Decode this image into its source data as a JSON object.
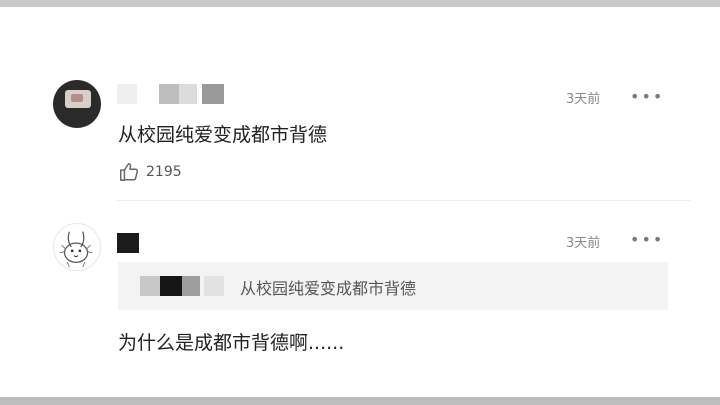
{
  "comments": [
    {
      "time": "3天前",
      "more": "•••",
      "text": "从校园纯爱变成都市背德",
      "likes": "2195"
    },
    {
      "time": "3天前",
      "more": "•••",
      "quote": "从校园纯爱变成都市背德",
      "text": "为什么是成都市背德啊......"
    }
  ],
  "icons": {
    "like": "thumbs-up-icon",
    "more": "more-dots-icon"
  },
  "colors": {
    "text": "#222222",
    "muted": "#8a8a8a",
    "quote_bg": "#f3f3f3"
  }
}
